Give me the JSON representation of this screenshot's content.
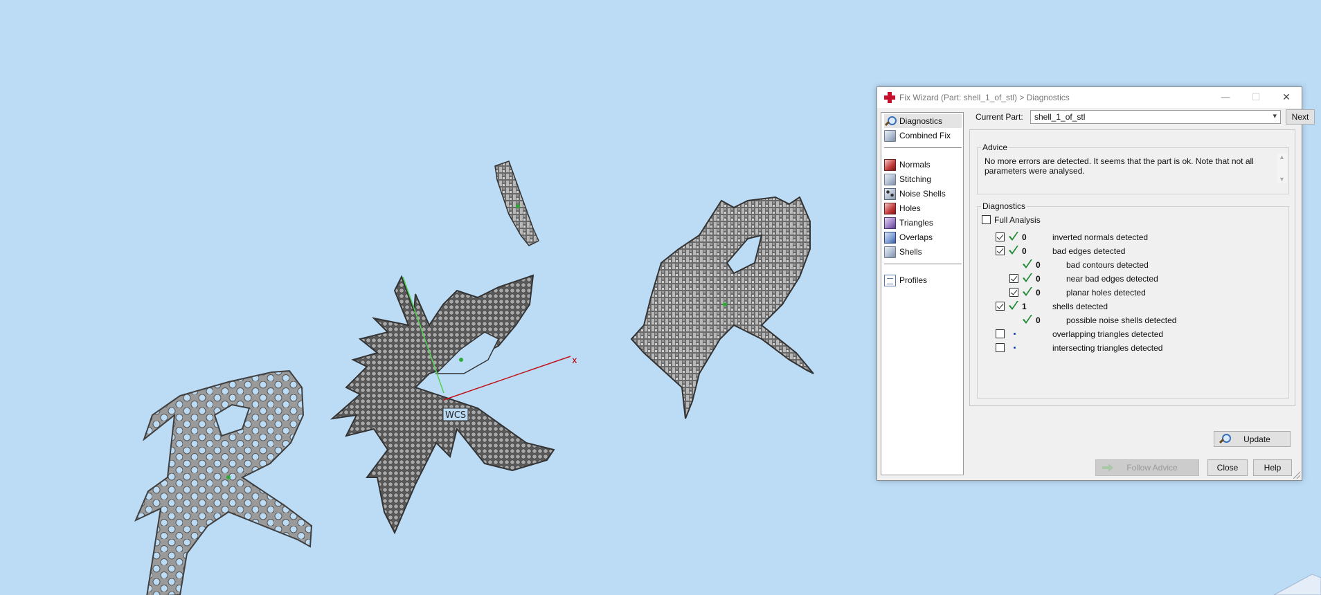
{
  "dialog": {
    "title": "Fix Wizard (Part: shell_1_of_stl) > Diagnostics",
    "window_buttons": {
      "minimize": "—",
      "maximize": "☐",
      "close": "✕"
    }
  },
  "nav": {
    "items": [
      {
        "label": "Diagnostics",
        "icon": "magnifier-icon",
        "active": true
      },
      {
        "label": "Combined Fix",
        "icon": "cube-icon"
      },
      {
        "label": "Normals",
        "icon": "normals-cube-icon"
      },
      {
        "label": "Stitching",
        "icon": "stitching-cube-icon"
      },
      {
        "label": "Noise Shells",
        "icon": "noise-shells-icon"
      },
      {
        "label": "Holes",
        "icon": "holes-cube-icon"
      },
      {
        "label": "Triangles",
        "icon": "triangles-icon"
      },
      {
        "label": "Overlaps",
        "icon": "overlaps-icon"
      },
      {
        "label": "Shells",
        "icon": "shells-icon"
      },
      {
        "label": "Profiles",
        "icon": "document-icon"
      }
    ]
  },
  "part": {
    "label": "Current Part:",
    "value": "shell_1_of_stl",
    "next_label": "Next"
  },
  "advice": {
    "title": "Advice",
    "text": "No more errors are detected. It seems that the part is ok. Note that not all parameters were analysed."
  },
  "diagnostics": {
    "title": "Diagnostics",
    "full_analysis_label": "Full Analysis",
    "full_analysis_checked": false,
    "rows": [
      {
        "checkbox": true,
        "checked": true,
        "status": "ok",
        "count": "0",
        "label": "inverted normals detected",
        "indent": 0
      },
      {
        "checkbox": true,
        "checked": true,
        "status": "ok",
        "count": "0",
        "label": "bad edges detected",
        "indent": 0
      },
      {
        "checkbox": false,
        "checked": false,
        "status": "ok",
        "count": "0",
        "label": "bad contours detected",
        "indent": 1
      },
      {
        "checkbox": true,
        "checked": true,
        "status": "ok",
        "count": "0",
        "label": "near bad edges detected",
        "indent": 1
      },
      {
        "checkbox": true,
        "checked": true,
        "status": "ok",
        "count": "0",
        "label": "planar holes detected",
        "indent": 1
      },
      {
        "checkbox": true,
        "checked": true,
        "status": "ok",
        "count": "1",
        "label": "shells detected",
        "indent": 0
      },
      {
        "checkbox": false,
        "checked": false,
        "status": "ok",
        "count": "0",
        "label": "possible noise shells detected",
        "indent": 1
      },
      {
        "checkbox": true,
        "checked": false,
        "status": "not-run",
        "count": "",
        "label": "overlapping triangles detected",
        "indent": 0
      },
      {
        "checkbox": true,
        "checked": false,
        "status": "not-run",
        "count": "",
        "label": "intersecting triangles detected",
        "indent": 0
      }
    ],
    "update_label": "Update"
  },
  "footer": {
    "follow_advice_label": "Follow Advice",
    "close_label": "Close",
    "help_label": "Help"
  },
  "viewport": {
    "wcs_label": "WCS",
    "x_axis_label": "x",
    "background": "#bcdcf6",
    "part_color": "#8c8c8c"
  }
}
